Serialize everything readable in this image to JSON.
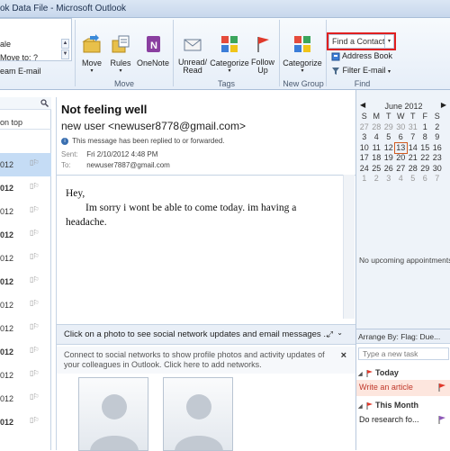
{
  "window": {
    "title": "ok Data File - Microsoft Outlook"
  },
  "ribbon": {
    "quick_steps": [
      "ale",
      "Move to: ?",
      "eam E-mail"
    ],
    "move_group": {
      "label": "Move",
      "buttons": [
        {
          "label": "Move",
          "icon": "move-to-folder-icon"
        },
        {
          "label": "Rules",
          "icon": "rules-icon"
        },
        {
          "label": "OneNote",
          "icon": "onenote-icon"
        }
      ]
    },
    "tags_group": {
      "label": "Tags",
      "buttons": [
        {
          "label": "Unread/ Read",
          "icon": "envelope-icon"
        },
        {
          "label": "Categorize",
          "icon": "categorize-icon"
        },
        {
          "label": "Follow Up",
          "icon": "flag-icon"
        }
      ]
    },
    "new_group": {
      "label": "New Group",
      "buttons": [
        {
          "label": "Categorize",
          "icon": "categorize-icon"
        }
      ]
    },
    "find_group": {
      "label": "Find",
      "find_contact_placeholder": "Find a Contact",
      "address_book": "Address Book",
      "filter_email": "Filter E-mail"
    }
  },
  "message_list": {
    "sort_label": "on top",
    "rows": [
      {
        "date": "012",
        "bold": false
      },
      {
        "date": "012",
        "bold": true
      },
      {
        "date": "012",
        "bold": false
      },
      {
        "date": "012",
        "bold": true
      },
      {
        "date": "012",
        "bold": false
      },
      {
        "date": "012",
        "bold": true
      },
      {
        "date": "012",
        "bold": false
      },
      {
        "date": "012",
        "bold": false
      },
      {
        "date": "012",
        "bold": true
      },
      {
        "date": "012",
        "bold": false
      },
      {
        "date": "012",
        "bold": false
      },
      {
        "date": "012",
        "bold": true
      }
    ]
  },
  "reading_pane": {
    "subject": "Not feeling well",
    "sender": "new user <newuser8778@gmail.com>",
    "info": "This message has been replied to or forwarded.",
    "sent_label": "Sent:",
    "sent_value": "Fri 2/10/2012 4:48 PM",
    "to_label": "To:",
    "to_value": "newuser7887@gmail.com",
    "body": [
      "Hey,",
      "Im sorry i wont be able to come today. im having a",
      "headache."
    ]
  },
  "social": {
    "header": "Click on a photo to see social network updates and email messages ...",
    "info_line1": "Connect to social networks to show profile photos and activity updates of",
    "info_line2": "your colleagues in Outlook. Click here to add networks."
  },
  "todo_bar": {
    "month": "June 2012",
    "weekdays": [
      "S",
      "M",
      "T",
      "W",
      "T",
      "F",
      "S"
    ],
    "weeks": [
      [
        "27",
        "28",
        "29",
        "30",
        "31",
        "1",
        "2"
      ],
      [
        "3",
        "4",
        "5",
        "6",
        "7",
        "8",
        "9"
      ],
      [
        "10",
        "11",
        "12",
        "13",
        "14",
        "15",
        "16"
      ],
      [
        "17",
        "18",
        "19",
        "20",
        "21",
        "22",
        "23"
      ],
      [
        "24",
        "25",
        "26",
        "27",
        "28",
        "29",
        "30"
      ],
      [
        "1",
        "2",
        "3",
        "4",
        "5",
        "6",
        "7"
      ]
    ],
    "today": "13",
    "no_appointments": "No upcoming appointments.",
    "arrange_by": "Arrange By: Flag: Due...",
    "new_task_placeholder": "Type a new task",
    "groups": [
      {
        "label": "Today",
        "tasks": [
          {
            "label": "Write an article",
            "color": "#c0392b"
          }
        ]
      },
      {
        "label": "This Month",
        "tasks": [
          {
            "label": "Do research fo...",
            "color": "#222222"
          }
        ]
      }
    ]
  },
  "colors": {
    "accent": "#3a6fb0",
    "highlight_box": "#e02020",
    "task_red": "#c0392b"
  }
}
